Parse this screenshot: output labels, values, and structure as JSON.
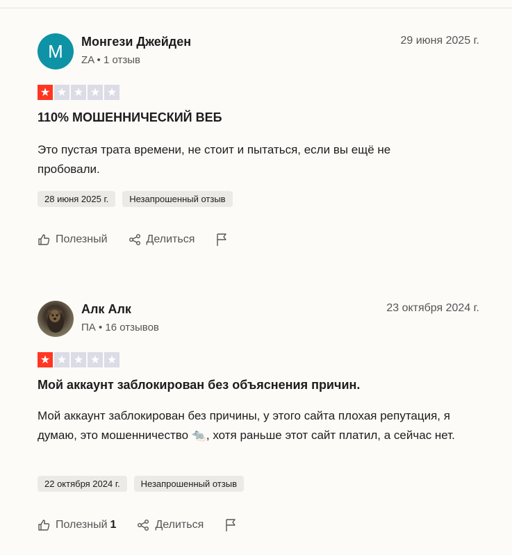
{
  "reviews": [
    {
      "avatar_letter": "M",
      "avatar_color": "#0d93a5",
      "author": "Монгези Джейден",
      "country": "ZA",
      "review_count": "1 отзыв",
      "date": "29 июня 2025 г.",
      "rating": 1,
      "title": "110% МОШЕННИЧЕСКИЙ ВЕБ",
      "text": "Это пустая трата времени, не стоит и пытаться, если вы ещё не пробовали.",
      "experience_date": "28 июня 2025 г.",
      "tag": "Незапрошенный отзыв",
      "useful_label": "Полезный",
      "useful_count": "",
      "share_label": "Делиться",
      "flag_icon": "flag-icon"
    },
    {
      "avatar_letter": "",
      "avatar_color": "",
      "author": "Алк Алк",
      "country": "ПА",
      "review_count": "16 отзывов",
      "date": "23 октября 2024 г.",
      "rating": 1,
      "title": "Мой аккаунт заблокирован без объяснения причин.",
      "text": "Мой аккаунт заблокирован без причины, у этого сайта плохая репутация, я думаю, это мошенничество 🐀, хотя раньше этот сайт платил, а сейчас нет.",
      "experience_date": "22 октября 2024 г.",
      "tag": "Незапрошенный отзыв",
      "useful_label": "Полезный",
      "useful_count": "1",
      "share_label": "Делиться",
      "flag_icon": "flag-icon"
    }
  ],
  "colors": {
    "star_filled": "#ff3722",
    "star_empty": "#dcdce6",
    "background": "#fcfbf8"
  }
}
